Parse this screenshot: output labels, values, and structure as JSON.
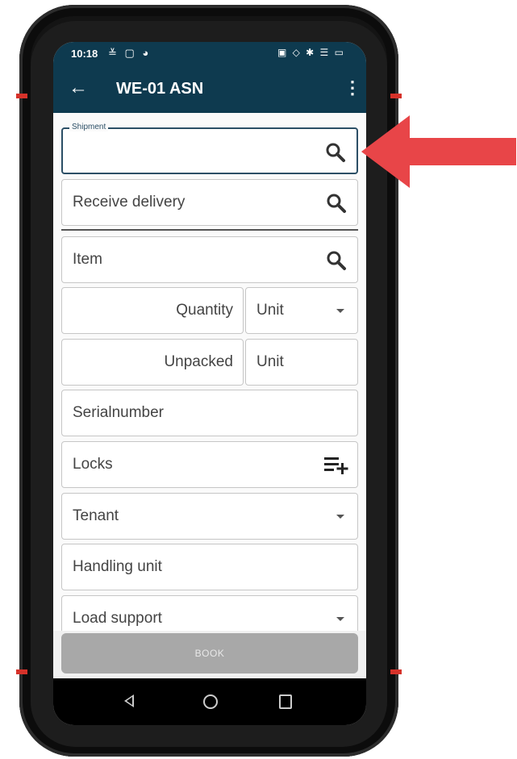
{
  "status_bar": {
    "time": "10:18",
    "left_icons": "≚ ▢ ◕",
    "right_icons": "▣ ◇ ✱ ☰ ▭"
  },
  "app_bar": {
    "back_glyph": "←",
    "title": "WE-01 ASN",
    "menu_glyph": "⋮"
  },
  "form": {
    "shipment": {
      "label": "Shipment",
      "value": ""
    },
    "receive_delivery": {
      "label": "Receive delivery"
    },
    "item": {
      "label": "Item"
    },
    "quantity": {
      "label": "Quantity",
      "unit": "Unit"
    },
    "unpacked": {
      "label": "Unpacked",
      "unit": "Unit"
    },
    "serialnumber": {
      "label": "Serialnumber"
    },
    "locks": {
      "label": "Locks"
    },
    "tenant": {
      "label": "Tenant"
    },
    "handling_unit": {
      "label": "Handling unit"
    },
    "load_support": {
      "label": "Load support"
    },
    "book_button": "BOOK"
  },
  "colors": {
    "app_bar": "#0e3a4f",
    "accent_arrow": "#e84548",
    "device_accent": "#d6322a"
  }
}
